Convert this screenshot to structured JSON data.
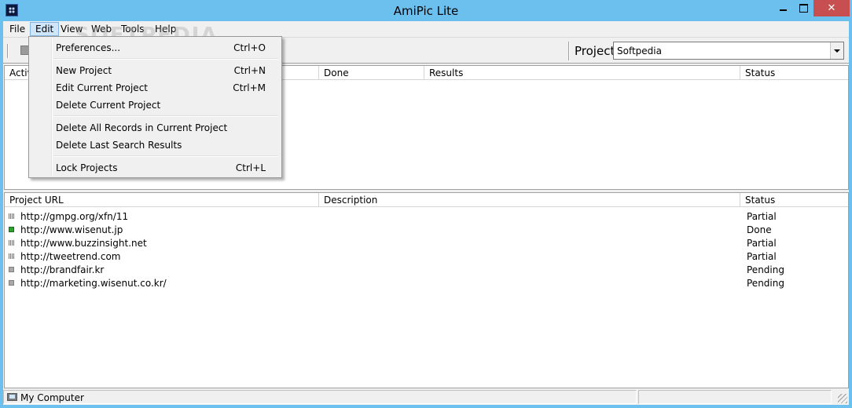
{
  "window": {
    "title": "AmiPic Lite"
  },
  "watermark": "SOFTPEDIA",
  "menubar": {
    "items": [
      {
        "id": "file",
        "label": "File"
      },
      {
        "id": "edit",
        "label": "Edit"
      },
      {
        "id": "view",
        "label": "View"
      },
      {
        "id": "web",
        "label": "Web"
      },
      {
        "id": "tools",
        "label": "Tools"
      },
      {
        "id": "help",
        "label": "Help"
      }
    ]
  },
  "toolbar": {
    "project_label": "Project",
    "project_value": "Softpedia"
  },
  "top_panel": {
    "columns": [
      "Active",
      "Done",
      "Results",
      "Status"
    ]
  },
  "bottom_panel": {
    "columns": [
      "Project URL",
      "Description",
      "Status"
    ],
    "rows": [
      {
        "url": "http://gmpg.org/xfn/11",
        "status": "Partial",
        "icon": "partial-icon"
      },
      {
        "url": "http://www.wisenut.jp",
        "status": "Done",
        "icon": "done-icon"
      },
      {
        "url": "http://www.buzzinsight.net",
        "status": "Partial",
        "icon": "partial-icon"
      },
      {
        "url": "http://tweetrend.com",
        "status": "Partial",
        "icon": "partial-icon"
      },
      {
        "url": "http://brandfair.kr",
        "status": "Pending",
        "icon": "pending-icon"
      },
      {
        "url": "http://marketing.wisenut.co.kr/",
        "status": "Pending",
        "icon": "pending-icon"
      }
    ]
  },
  "edit_menu": {
    "items": [
      {
        "label": "Preferences...",
        "shortcut": "Ctrl+O"
      },
      {
        "label": "New Project",
        "shortcut": "Ctrl+N"
      },
      {
        "label": "Edit Current Project",
        "shortcut": "Ctrl+M"
      },
      {
        "label": "Delete Current Project",
        "shortcut": ""
      },
      {
        "label": "Delete All Records in Current Project",
        "shortcut": ""
      },
      {
        "label": "Delete Last Search Results",
        "shortcut": ""
      },
      {
        "label": "Lock Projects",
        "shortcut": "Ctrl+L"
      }
    ]
  },
  "statusbar": {
    "text": "My Computer"
  },
  "colors": {
    "frame": "#6cc0ee",
    "close": "#c74f4f",
    "menu_highlight": "#cfe5f9",
    "status_green": "#2ea02e"
  }
}
